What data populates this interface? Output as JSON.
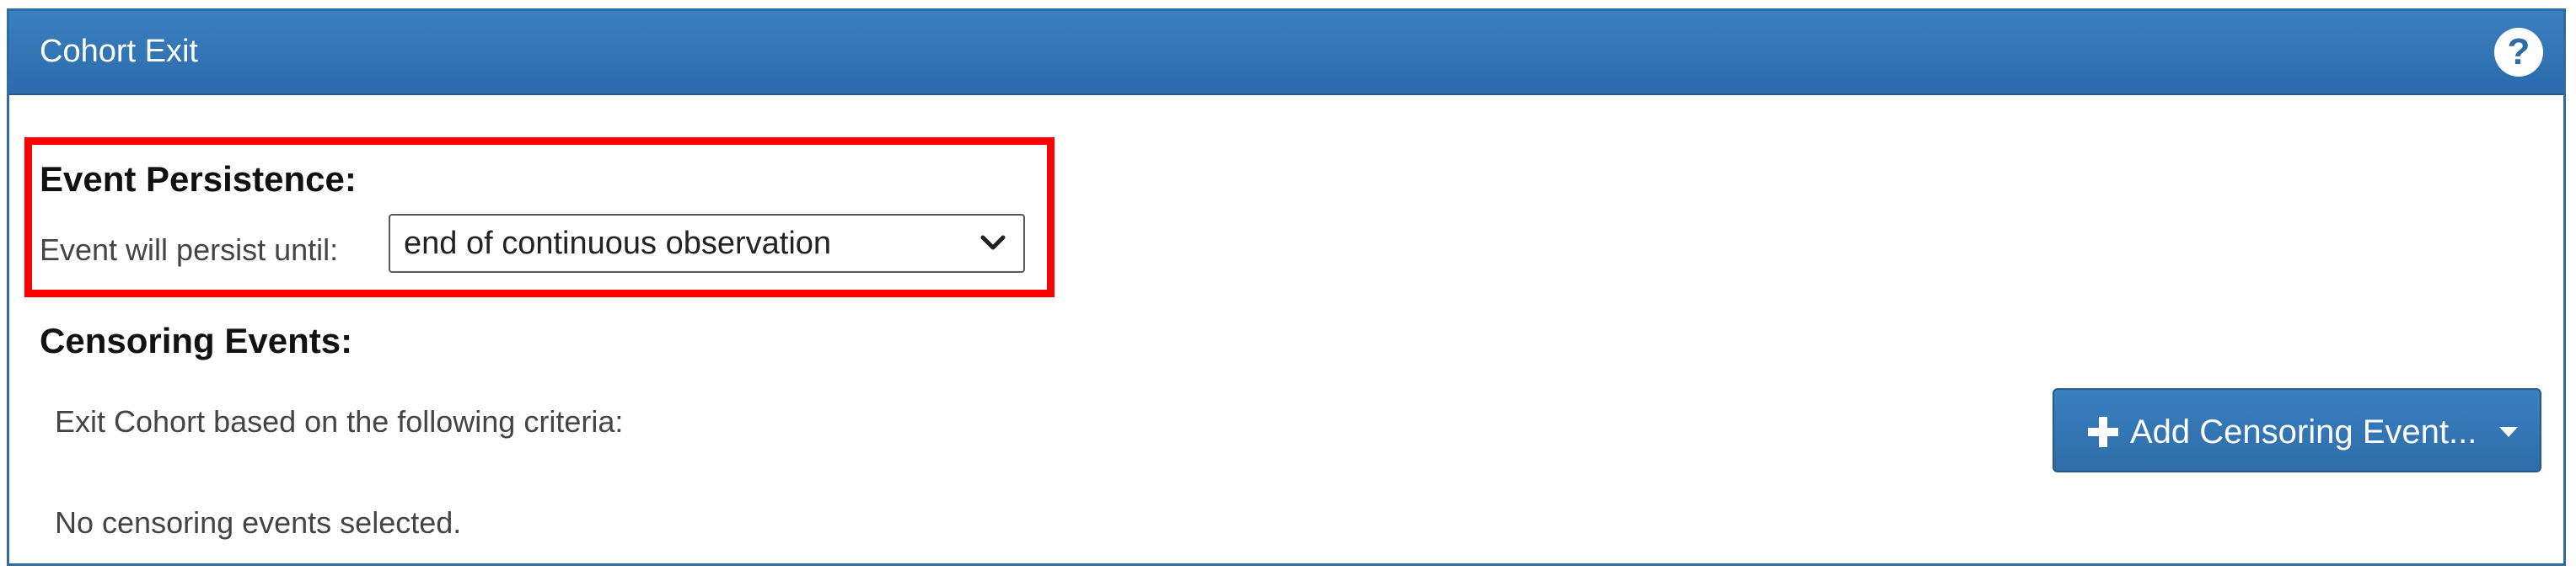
{
  "panel": {
    "title": "Cohort Exit",
    "help_icon": "question-circle-icon",
    "help_glyph": "?"
  },
  "event_persistence": {
    "heading": "Event Persistence:",
    "label": "Event will persist until:",
    "selected": "end of continuous observation",
    "chevron_icon": "chevron-down-icon"
  },
  "censoring": {
    "heading": "Censoring Events:",
    "criteria_text": "Exit Cohort based on the following criteria:",
    "empty_text": "No censoring events selected.",
    "add_button_label": "Add Censoring Event...",
    "add_icon": "plus-icon",
    "dropdown_icon": "caret-down-icon"
  },
  "colors": {
    "header_bg": "#2e6da4",
    "highlight_border": "#ff0000",
    "button_bg": "#337ab7",
    "text": "#444444"
  }
}
